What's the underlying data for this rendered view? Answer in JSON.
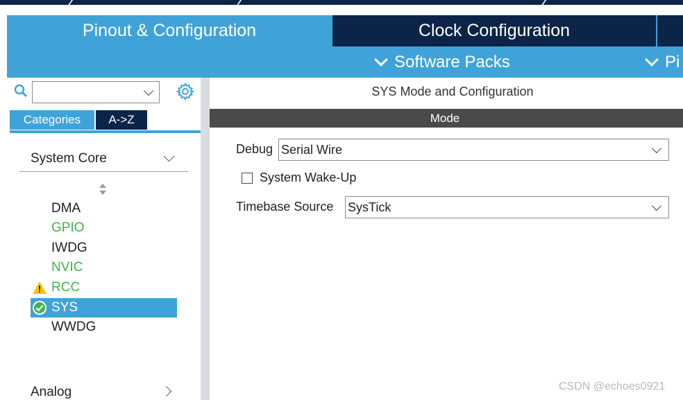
{
  "tabs": {
    "pinout": "Pinout & Configuration",
    "clock": "Clock Configuration"
  },
  "subbar": {
    "software_packs": "Software Packs",
    "pinout_truncated": "Pi"
  },
  "left": {
    "search": {
      "value": "",
      "search_icon": "search-icon",
      "gear_icon": "gear-icon"
    },
    "category_tabs": [
      "Categories",
      "A->Z"
    ],
    "sections": {
      "system_core": "System Core",
      "analog": "Analog"
    },
    "items": [
      {
        "label": "DMA",
        "state": "normal"
      },
      {
        "label": "GPIO",
        "state": "configured"
      },
      {
        "label": "IWDG",
        "state": "normal"
      },
      {
        "label": "NVIC",
        "state": "configured"
      },
      {
        "label": "RCC",
        "state": "warning",
        "icon": "warning-icon"
      },
      {
        "label": "SYS",
        "state": "selected",
        "icon": "check-circle-icon"
      },
      {
        "label": "WWDG",
        "state": "normal"
      }
    ]
  },
  "right": {
    "title": "SYS Mode and Configuration",
    "mode_header": "Mode",
    "debug": {
      "label": "Debug",
      "value": "Serial Wire"
    },
    "wakeup": {
      "label": "System Wake-Up",
      "checked": false
    },
    "timebase": {
      "label": "Timebase Source",
      "value": "SysTick"
    }
  },
  "watermark": "CSDN @echoes0921",
  "colors": {
    "accent_blue": "#3fa3d9",
    "navy": "#0b2447",
    "configured_green": "#3cb44b",
    "warning_yellow": "#f5c400",
    "mode_bar_gray": "#4a4a4a"
  }
}
